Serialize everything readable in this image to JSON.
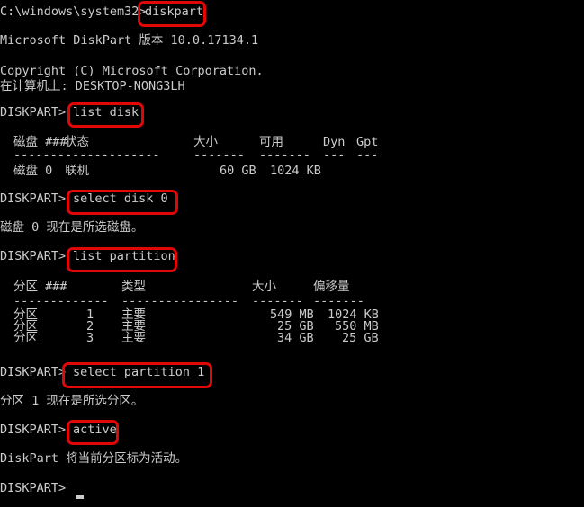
{
  "window": {
    "kind": "windows-command-prompt",
    "background_color": "#000000",
    "text_color": "#cccccc",
    "highlight_color": "#e10707"
  },
  "prompt": {
    "cmd_path": "C:\\windows\\system32>",
    "diskpart_prompt": "DISKPART>"
  },
  "lines": {
    "l1_path": "C:\\windows\\system32>",
    "l1_command": "diskpart",
    "l2_version": "Microsoft DiskPart 版本 10.0.17134.1",
    "l3_copyright": "Copyright (C) Microsoft Corporation.",
    "l4_computer": "在计算机上: DESKTOP-NONG3LH",
    "l5_prompt": "DISKPART>",
    "l5_command": "list disk",
    "l10_prompt": "DISKPART>",
    "l10_command": "select disk 0",
    "l11_result": "磁盘 0 现在是所选磁盘。",
    "l12_prompt": "DISKPART>",
    "l12_command": "list partition",
    "l18_prompt": "DISKPART>",
    "l18_command": "select partition 1",
    "l19_result": "分区 1 现在是所选分区。",
    "l20_prompt": "DISKPART>",
    "l20_command": "active",
    "l21_result": "DiskPart 将当前分区标为活动。",
    "l22_prompt": "DISKPART>",
    "cursor": "_"
  },
  "disk_table": {
    "headers": {
      "disk": "磁盘 ###",
      "status": "状态",
      "size": "大小",
      "free": "可用",
      "dyn": "Dyn",
      "gpt": "Gpt"
    },
    "rules": {
      "disk": "--------",
      "status": "-------------",
      "size": "-------",
      "free": "-------",
      "dyn": "---",
      "gpt": "---"
    },
    "rows": [
      {
        "disk": "磁盘 0",
        "status": "联机",
        "size": "60 GB",
        "free": "1024 KB",
        "dyn": "",
        "gpt": ""
      }
    ]
  },
  "partition_table": {
    "headers": {
      "partition": "分区 ###",
      "type": "类型",
      "size": "大小",
      "offset": "偏移量"
    },
    "rules": {
      "partition": "-------------",
      "type": "----------------",
      "size": "-------",
      "offset": "-------"
    },
    "rows": [
      {
        "partition": "分区",
        "number": "1",
        "type": "主要",
        "size": "549 MB",
        "offset": "1024 KB"
      },
      {
        "partition": "分区",
        "number": "2",
        "type": "主要",
        "size": "25 GB",
        "offset": "550 MB"
      },
      {
        "partition": "分区",
        "number": "3",
        "type": "主要",
        "size": "34 GB",
        "offset": "25 GB"
      }
    ]
  },
  "highlights": [
    {
      "name": "highlight-diskpart",
      "label": "diskpart"
    },
    {
      "name": "highlight-list-disk",
      "label": "list disk"
    },
    {
      "name": "highlight-select-disk-0",
      "label": "select disk 0"
    },
    {
      "name": "highlight-list-partition",
      "label": "list partition"
    },
    {
      "name": "highlight-select-partition-1",
      "label": "select partition 1"
    },
    {
      "name": "highlight-active",
      "label": "active"
    }
  ]
}
